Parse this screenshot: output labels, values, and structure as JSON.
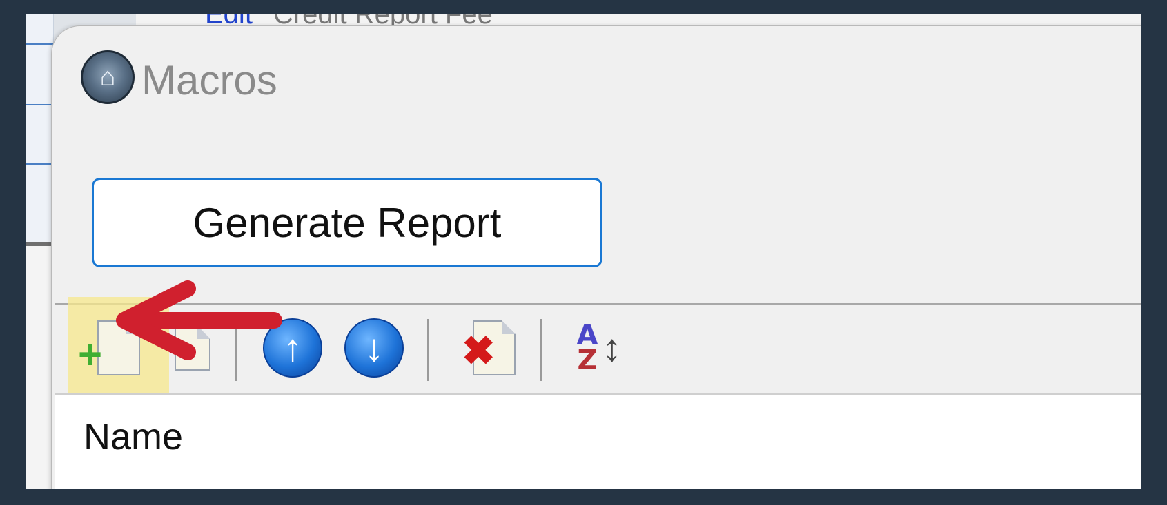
{
  "background_window": {
    "link_fragment": "Edit",
    "title_fragment": "Credit Report Fee"
  },
  "dialog": {
    "title": "Macros",
    "title_icon": "home-icon"
  },
  "primary_action": {
    "label": "Generate Report"
  },
  "toolbar": {
    "buttons": [
      {
        "name": "add-new-icon",
        "tooltip": ""
      },
      {
        "name": "edit-icon",
        "tooltip": ""
      },
      {
        "name": "move-up-icon",
        "glyph": "↑"
      },
      {
        "name": "move-down-icon",
        "glyph": "↓"
      },
      {
        "name": "delete-icon",
        "glyph": "✖"
      },
      {
        "name": "sort-az-icon",
        "a": "A",
        "z": "Z",
        "arrow": "↕"
      }
    ]
  },
  "list": {
    "columns": [
      "Name"
    ]
  },
  "annotation": {
    "highlight_color": "#f7e88c",
    "arrow_color": "#d0202e"
  }
}
